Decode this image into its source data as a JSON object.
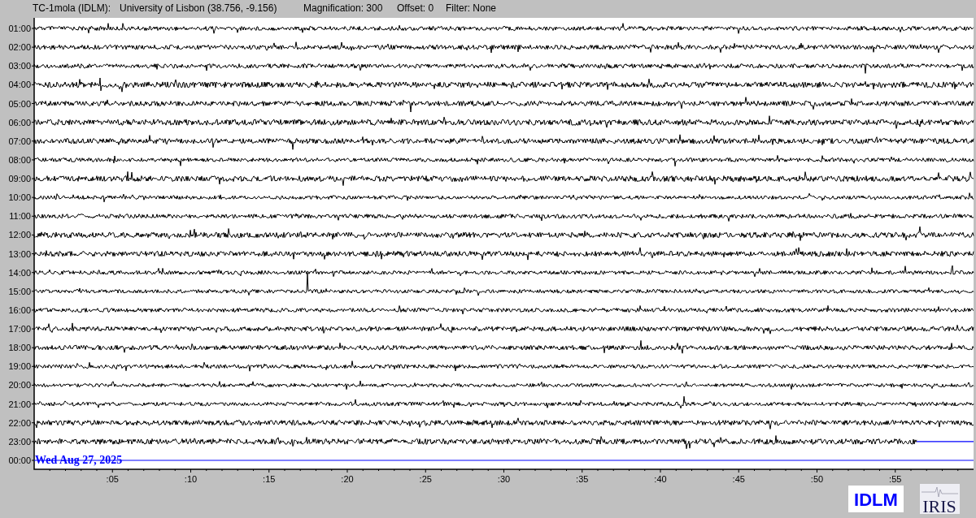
{
  "header": {
    "station": "TC-1mola (IDLM):",
    "location": "University of Lisbon (38.756, -9.156)",
    "magnification": "Magnification: 300",
    "offset": "Offset: 0",
    "filter": "Filter: None"
  },
  "rows": [
    {
      "label": "01:00",
      "kind": "full"
    },
    {
      "label": "02:00",
      "kind": "full"
    },
    {
      "label": "03:00",
      "kind": "full"
    },
    {
      "label": "04:00",
      "kind": "full"
    },
    {
      "label": "05:00",
      "kind": "full"
    },
    {
      "label": "06:00",
      "kind": "full"
    },
    {
      "label": "07:00",
      "kind": "full"
    },
    {
      "label": "08:00",
      "kind": "full"
    },
    {
      "label": "09:00",
      "kind": "full"
    },
    {
      "label": "10:00",
      "kind": "full"
    },
    {
      "label": "11:00",
      "kind": "full"
    },
    {
      "label": "12:00",
      "kind": "full"
    },
    {
      "label": "13:00",
      "kind": "full"
    },
    {
      "label": "14:00",
      "kind": "full"
    },
    {
      "label": "15:00",
      "kind": "full"
    },
    {
      "label": "16:00",
      "kind": "full"
    },
    {
      "label": "17:00",
      "kind": "full"
    },
    {
      "label": "18:00",
      "kind": "full"
    },
    {
      "label": "19:00",
      "kind": "full"
    },
    {
      "label": "20:00",
      "kind": "full"
    },
    {
      "label": "21:00",
      "kind": "full"
    },
    {
      "label": "22:00",
      "kind": "full"
    },
    {
      "label": "23:00",
      "kind": "partial"
    },
    {
      "label": "00:00",
      "kind": "blank"
    }
  ],
  "date_label": "Wed Aug 27, 2025",
  "x_ticks": [
    ":05",
    ":10",
    ":15",
    ":20",
    ":25",
    ":30",
    ":35",
    ":40",
    ":45",
    ":50",
    ":55"
  ],
  "logos": {
    "network": "IDLM",
    "organization": "IRIS"
  }
}
